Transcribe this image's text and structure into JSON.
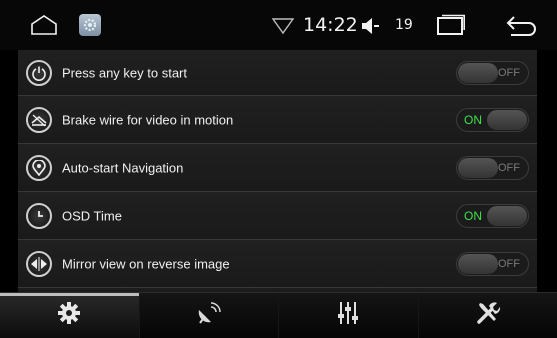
{
  "statusbar": {
    "time": "14:22",
    "volume": "19",
    "icons": {
      "home": "home-icon",
      "settings_app": "settings-app-icon",
      "wifi": "wifi-signal-icon",
      "volume": "speaker-icon",
      "recents": "recent-apps-icon",
      "back": "back-icon"
    }
  },
  "settings": [
    {
      "label": "Press any key to start",
      "icon": "power-icon",
      "state": "OFF"
    },
    {
      "label": "Brake wire for video in motion",
      "icon": "brake-icon",
      "state": "ON"
    },
    {
      "label": "Auto-start Navigation",
      "icon": "location-pin-icon",
      "state": "OFF"
    },
    {
      "label": "OSD Time",
      "icon": "clock-icon",
      "state": "ON"
    },
    {
      "label": "Mirror view on reverse image",
      "icon": "mirror-icon",
      "state": "OFF"
    }
  ],
  "tabs": [
    {
      "name": "gear-icon",
      "active": true
    },
    {
      "name": "satellite-dish-icon",
      "active": false
    },
    {
      "name": "equalizer-icon",
      "active": false
    },
    {
      "name": "tools-icon",
      "active": false
    }
  ],
  "colors": {
    "on": "#3ee14a",
    "off": "#7a7a7a"
  }
}
